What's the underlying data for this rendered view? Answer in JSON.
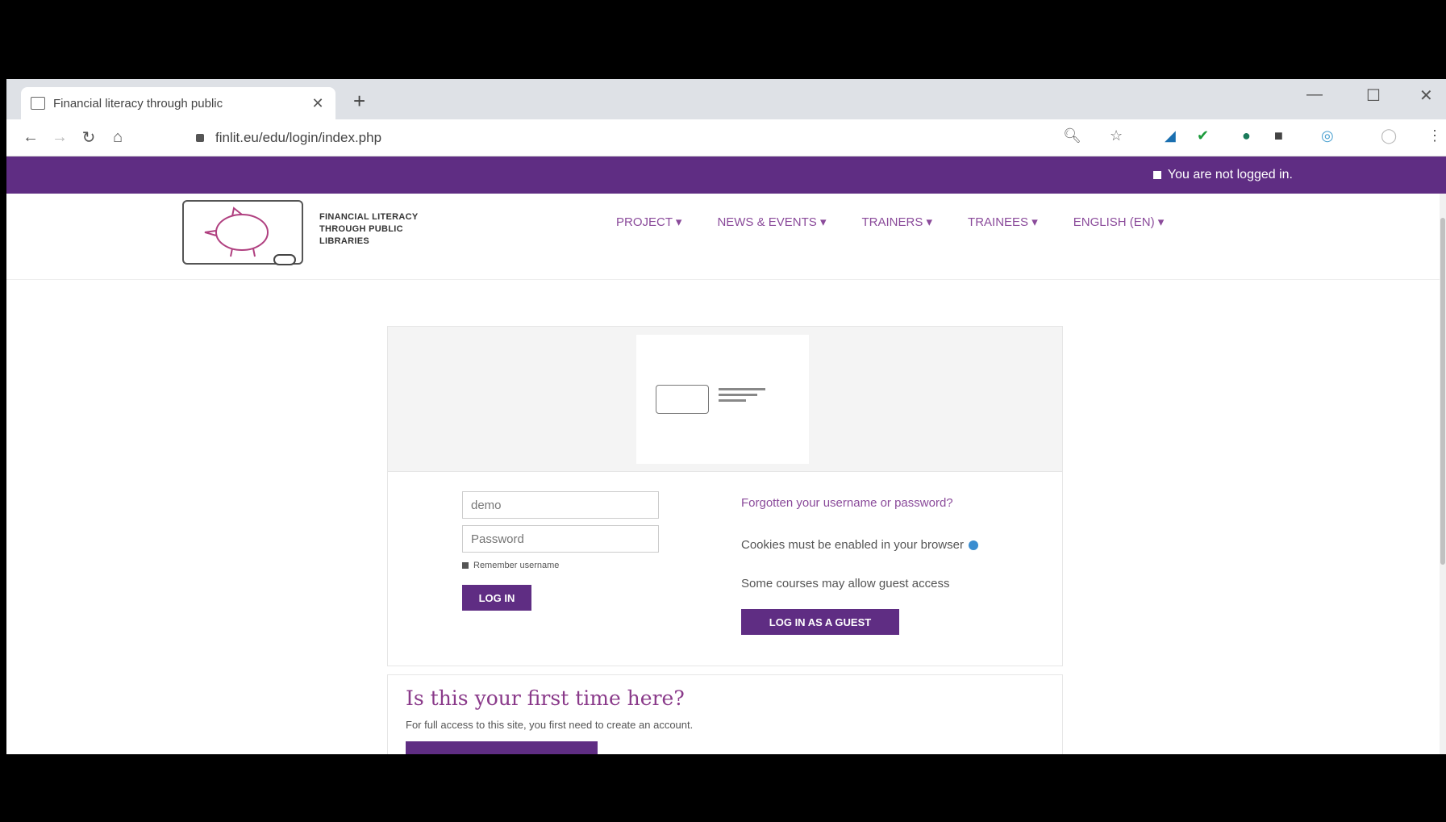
{
  "browser": {
    "tab_title": "Financial literacy through public",
    "tab_close": "✕",
    "new_tab": "+",
    "url": "finlit.eu/edu/login/index.php",
    "win_minimize": "—",
    "win_maximize": "☐",
    "win_close": "✕"
  },
  "topbar": {
    "status": "You are not logged in."
  },
  "header": {
    "logo_text": [
      "FINANCIAL LITERACY",
      "THROUGH PUBLIC",
      "LIBRARIES"
    ],
    "menu": [
      {
        "label": "PROJECT ▾"
      },
      {
        "label": "NEWS & EVENTS ▾"
      },
      {
        "label": "TRAINERS ▾"
      },
      {
        "label": "TRAINEES ▾"
      },
      {
        "label": "ENGLISH (EN) ▾"
      }
    ]
  },
  "login": {
    "username_value": "demo",
    "password_placeholder": "Password",
    "remember_label": "Remember username",
    "login_button": "LOG IN",
    "forgot_link": "Forgotten your username or password?",
    "cookies_text": "Cookies must be enabled in your browser",
    "guest_text": "Some courses may allow guest access",
    "guest_button": "LOG IN AS A GUEST"
  },
  "signup": {
    "title": "Is this your first time here?",
    "text": "For full access to this site, you first need to create an account."
  },
  "colors": {
    "brand_purple": "#5f2d83",
    "link_purple": "#8a4a9a"
  }
}
